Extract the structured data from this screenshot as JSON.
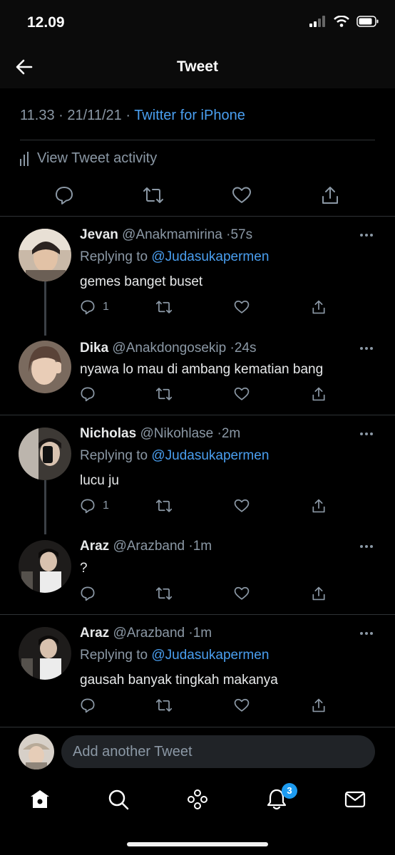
{
  "status_bar": {
    "time": "12.09"
  },
  "nav": {
    "title": "Tweet"
  },
  "tweet_meta": {
    "time": "11.33",
    "date": "21/11/21",
    "source": "Twitter for iPhone",
    "sep": "·"
  },
  "activity_label": "View Tweet activity",
  "replies": [
    {
      "name": "Jevan",
      "handle": "@Anakmamirina",
      "time": "57s",
      "replying_prefix": "Replying to",
      "replying_to": "@Judasukapermen",
      "text": "gemes banget buset",
      "reply_count": "1"
    },
    {
      "name": "Dika",
      "handle": "@Anakdongosekip",
      "time": "24s",
      "text": "nyawa lo mau di ambang kematian bang",
      "reply_count": ""
    },
    {
      "name": "Nicholas",
      "handle": "@Nikohlase",
      "time": "2m",
      "replying_prefix": "Replying to",
      "replying_to": "@Judasukapermen",
      "text": "lucu ju",
      "reply_count": "1"
    },
    {
      "name": "Araz",
      "handle": "@Arazband",
      "time": "1m",
      "text": "?",
      "reply_count": ""
    },
    {
      "name": "Araz",
      "handle": "@Arazband",
      "time": "1m",
      "replying_prefix": "Replying to",
      "replying_to": "@Judasukapermen",
      "text": "gausah banyak tingkah makanya",
      "reply_count": ""
    }
  ],
  "compose": {
    "placeholder": "Add another Tweet"
  },
  "tabbar": {
    "notification_badge": "3"
  },
  "colors": {
    "accent": "#1d9bf0",
    "link": "#4a9ff0",
    "muted": "#8b98a5",
    "background": "#000000"
  },
  "icons": [
    "back-arrow-icon",
    "reply-icon",
    "retweet-icon",
    "like-icon",
    "share-icon",
    "more-icon",
    "home-icon",
    "search-icon",
    "spaces-icon",
    "notifications-icon",
    "messages-icon"
  ]
}
